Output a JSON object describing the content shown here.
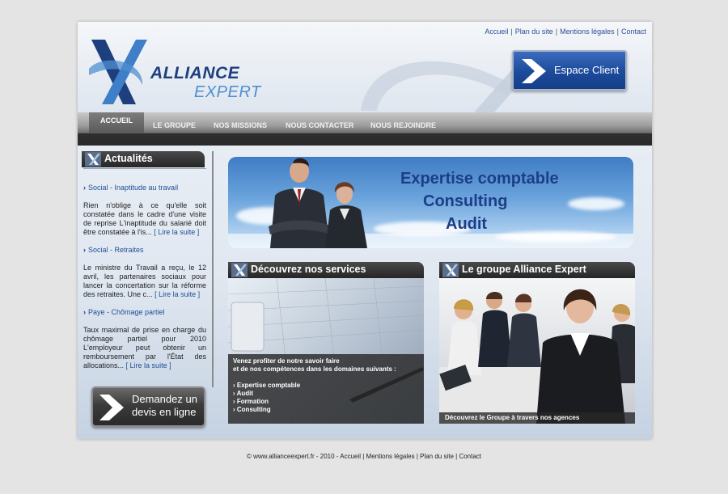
{
  "top_links": [
    "Accueil",
    "Plan du site",
    "Mentions légales",
    "Contact"
  ],
  "logo": {
    "word1": "ALLIANCE",
    "word2": "EXPERT"
  },
  "espace_client": "Espace Client",
  "nav": {
    "items": [
      "ACCUEIL",
      "LE GROUPE",
      "NOS MISSIONS",
      "NOUS CONTACTER",
      "NOUS REJOINDRE"
    ],
    "active": "ACCUEIL"
  },
  "news": {
    "title": "Actualités",
    "items": [
      {
        "title": "Social - Inaptitude au travail",
        "body": "Rien n'oblige à ce qu'elle soit constatée dans le cadre d'une visite de reprise L'inaptitude du salarié doit être constatée à l'is...",
        "more": "[ Lire la suite ]"
      },
      {
        "title": "Social - Retraites",
        "body": "Le ministre du Travail a reçu, le 12 avril, les partenaires sociaux pour lancer la concertation sur la réforme des retraites. Une c...",
        "more": "[ Lire la suite ]"
      },
      {
        "title": "Paye - Chômage partiel",
        "body": "Taux maximal de prise en charge du chômage partiel pour 2010 L'employeur peut obtenir un remboursement par l'État des allocations...",
        "more": "[ Lire la suite ]"
      }
    ]
  },
  "devis": {
    "line1": "Demandez un",
    "line2": "devis en ligne"
  },
  "banner": {
    "lines": [
      "Expertise comptable",
      "Consulting",
      "Audit"
    ]
  },
  "services": {
    "title": "Découvrez nos services",
    "intro1": "Venez profiter de notre savoir faire",
    "intro2": "et de nos compétences dans les domaines suivants :",
    "items": [
      "Expertise comptable",
      "Audit",
      "Formation",
      "Consulting"
    ]
  },
  "groupe": {
    "title": "Le groupe Alliance Expert",
    "caption": "Découvrez le Groupe à travers nos agences"
  },
  "footer": "© www.allianceexpert.fr - 2010 - Accueil | Mentions légales | Plan du site | Contact",
  "colors": {
    "accent": "#1c4a9b",
    "nav_dark": "#2a2a2a",
    "link": "#1f4f96"
  }
}
